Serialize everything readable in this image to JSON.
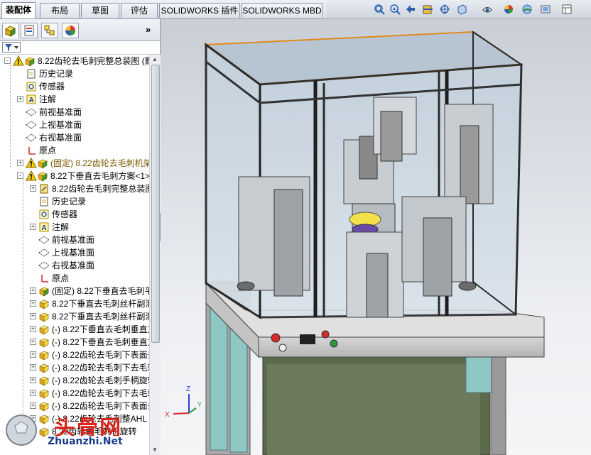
{
  "tabs": [
    "装配体",
    "布局",
    "草图",
    "评估",
    "SOLIDWORKS 插件",
    "SOLIDWORKS MBD"
  ],
  "active_tab": "装配体",
  "panel": {
    "collapse_glyph": "»",
    "filter_icon": "filter-icon"
  },
  "tree": [
    {
      "label": "8.22齿轮去毛刺完整总装图  (默",
      "icon": "assembly",
      "warn": true,
      "expand": "-",
      "level": 0
    },
    {
      "label": "历史记录",
      "icon": "history",
      "level": 1
    },
    {
      "label": "传感器",
      "icon": "sensor",
      "level": 1
    },
    {
      "label": "注解",
      "icon": "annotation",
      "expand": "+",
      "level": 1
    },
    {
      "label": "前视基准面",
      "icon": "plane",
      "level": 1
    },
    {
      "label": "上视基准面",
      "icon": "plane",
      "level": 1
    },
    {
      "label": "右视基准面",
      "icon": "plane",
      "level": 1
    },
    {
      "label": "原点",
      "icon": "origin",
      "level": 1
    },
    {
      "label": "(固定) 8.22齿轮去毛刺机架组",
      "icon": "assembly",
      "warn": true,
      "fixed": true,
      "expand": "+",
      "level": 1
    },
    {
      "label": "8.22下垂直去毛刺方案<1> (默认",
      "icon": "assembly",
      "warn": true,
      "expand": "-",
      "level": 1
    },
    {
      "label": "8.22齿轮去毛刺完整总装图",
      "icon": "part-doc",
      "expand": "+",
      "level": 2
    },
    {
      "label": "历史记录",
      "icon": "history",
      "level": 2
    },
    {
      "label": "传感器",
      "icon": "sensor",
      "level": 2
    },
    {
      "label": "注解",
      "icon": "annotation",
      "expand": "+",
      "level": 2
    },
    {
      "label": "前视基准面",
      "icon": "plane",
      "level": 2
    },
    {
      "label": "上视基准面",
      "icon": "plane",
      "level": 2
    },
    {
      "label": "右视基准面",
      "icon": "plane",
      "level": 2
    },
    {
      "label": "原点",
      "icon": "origin",
      "level": 2
    },
    {
      "label": "(固定) 8.22下垂直去毛刺平移",
      "icon": "assembly",
      "expand": "+",
      "level": 2
    },
    {
      "label": "8.22下垂直去毛刺丝杆副滑块",
      "icon": "part",
      "expand": "+",
      "level": 2
    },
    {
      "label": "8.22下垂直去毛刺丝杆副滑块",
      "icon": "part",
      "expand": "+",
      "level": 2
    },
    {
      "label": "(-) 8.22下垂直去毛刺垂直方",
      "icon": "part",
      "expand": "+",
      "level": 2
    },
    {
      "label": "(-) 8.22下垂直去毛刺垂直方",
      "icon": "part",
      "expand": "+",
      "level": 2
    },
    {
      "label": "(-) 8.22齿轮去毛刺下表面去",
      "icon": "part",
      "expand": "+",
      "level": 2
    },
    {
      "label": "(-) 8.22齿轮去毛刺下去毛刺",
      "icon": "part",
      "expand": "+",
      "level": 2
    },
    {
      "label": "(-) 8.22齿轮去毛刺手柄旋转",
      "icon": "part",
      "expand": "+",
      "level": 2
    },
    {
      "label": "(-) 8.22齿轮去毛刺下去毛刺",
      "icon": "part",
      "expand": "+",
      "level": 2
    },
    {
      "label": "(-) 8.22齿轮去毛刺下表面去",
      "icon": "part",
      "expand": "+",
      "level": 2
    },
    {
      "label": "(-) 8.22齿轮去毛刺整AHL",
      "icon": "part",
      "expand": "+",
      "level": 2
    },
    {
      "label": "8.22齿轮去毛刺机旋转",
      "icon": "part",
      "expand": "+",
      "level": 2
    }
  ],
  "watermark": {
    "text": "头骨网",
    "url": "Zhuanzhi.Net"
  },
  "triad": {
    "x": "X",
    "y": "Y",
    "z": "Z"
  },
  "colors": {
    "accent": "#e08a1e",
    "frame": "#1e1e1e",
    "glass": "#c8d7e4",
    "cabinet": "#8fc7c5"
  }
}
